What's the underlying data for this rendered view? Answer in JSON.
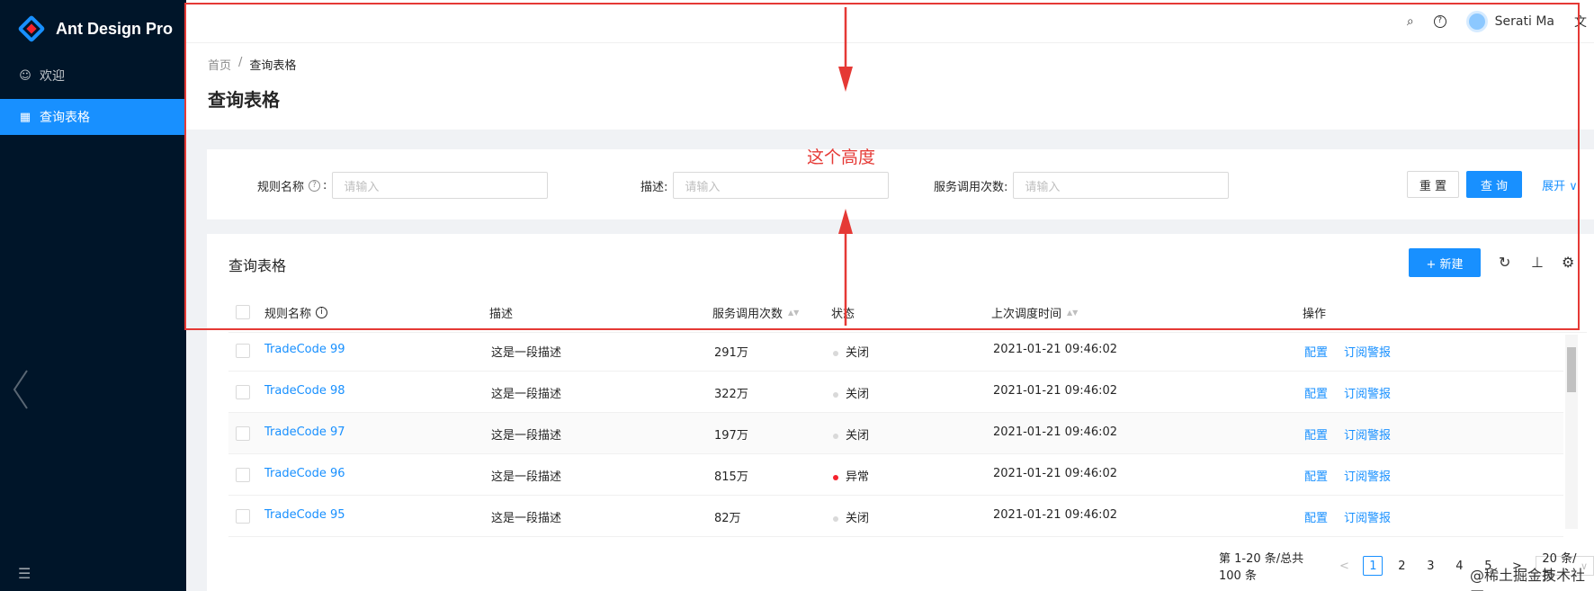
{
  "sidebar": {
    "logo_text": "Ant Design Pro",
    "items": [
      {
        "label": "欢迎",
        "icon": "smile-icon",
        "glyph": "☺"
      },
      {
        "label": "查询表格",
        "icon": "table-icon",
        "glyph": "▦"
      }
    ],
    "footer_glyph": "☰"
  },
  "header": {
    "search_glyph": "⌕",
    "help_glyph": "?",
    "user_name": "Serati Ma",
    "lang_glyph": "文"
  },
  "page": {
    "breadcrumb": [
      "首页",
      "/",
      "查询表格"
    ],
    "title": "查询表格"
  },
  "search_form": {
    "fields": [
      {
        "label": "规则名称",
        "placeholder": "请输入"
      },
      {
        "label": "描述:",
        "placeholder": "请输入"
      },
      {
        "label": "服务调用次数:",
        "placeholder": "请输入"
      }
    ],
    "colon": ":",
    "reset_label": "重 置",
    "query_label": "查 询",
    "expand_label": "展开 ∨"
  },
  "table": {
    "title": "查询表格",
    "new_label": "+ 新建",
    "toolbar_glyphs": {
      "reload": "↻",
      "density": "⊥",
      "settings": "⚙"
    },
    "columns": [
      "规则名称",
      "描述",
      "服务调用次数",
      "状态",
      "上次调度时间",
      "操作"
    ],
    "sort_glyph": "▲▼",
    "rows": [
      {
        "name": "TradeCode 99",
        "desc": "这是一段描述",
        "calls": "291万",
        "status": "关闭",
        "status_color": "#d9d9d9",
        "time": "2021-01-21 09:46:02",
        "action1": "配置",
        "action2": "订阅警报"
      },
      {
        "name": "TradeCode 98",
        "desc": "这是一段描述",
        "calls": "322万",
        "status": "关闭",
        "status_color": "#d9d9d9",
        "time": "2021-01-21 09:46:02",
        "action1": "配置",
        "action2": "订阅警报"
      },
      {
        "name": "TradeCode 97",
        "desc": "这是一段描述",
        "calls": "197万",
        "status": "关闭",
        "status_color": "#d9d9d9",
        "time": "2021-01-21 09:46:02",
        "action1": "配置",
        "action2": "订阅警报"
      },
      {
        "name": "TradeCode 96",
        "desc": "这是一段描述",
        "calls": "815万",
        "status": "异常",
        "status_color": "#f5222d",
        "time": "2021-01-21 09:46:02",
        "action1": "配置",
        "action2": "订阅警报"
      },
      {
        "name": "TradeCode 95",
        "desc": "这是一段描述",
        "calls": "82万",
        "status": "关闭",
        "status_color": "#d9d9d9",
        "time": "2021-01-21 09:46:02",
        "action1": "配置",
        "action2": "订阅警报"
      }
    ]
  },
  "pagination": {
    "total_text": "第 1-20 条/总共 100 条",
    "prev": "<",
    "pages": [
      "1",
      "2",
      "3",
      "4",
      "5"
    ],
    "next": ">",
    "page_size": "20 条/页",
    "page_size_arrow": "∨"
  },
  "annotation": {
    "label": "这个高度",
    "color": "#e53935"
  },
  "watermark": "@稀土掘金技术社区"
}
